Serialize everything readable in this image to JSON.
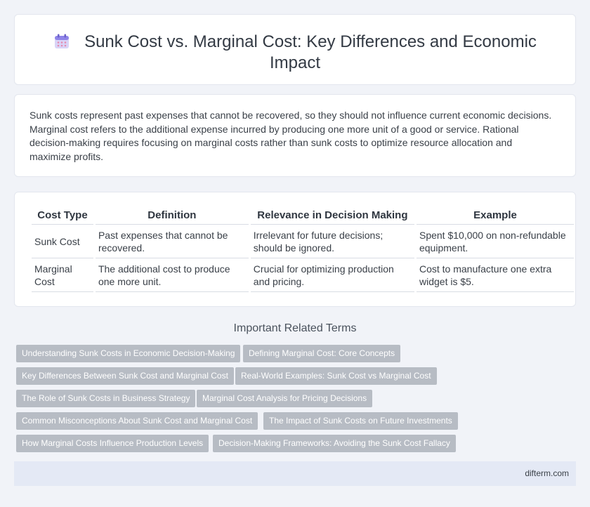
{
  "header": {
    "title": "Sunk Cost vs. Marginal Cost: Key Differences and Economic Impact",
    "icon": "calendar-icon"
  },
  "intro": {
    "text": "Sunk costs represent past expenses that cannot be recovered, so they should not influence current economic decisions. Marginal cost refers to the additional expense incurred by producing one more unit of a good or service. Rational decision-making requires focusing on marginal costs rather than sunk costs to optimize resource allocation and maximize profits."
  },
  "table": {
    "headers": [
      "Cost Type",
      "Definition",
      "Relevance in Decision Making",
      "Example"
    ],
    "rows": [
      [
        "Sunk Cost",
        "Past expenses that cannot be recovered.",
        "Irrelevant for future decisions; should be ignored.",
        "Spent $10,000 on non-refundable equipment."
      ],
      [
        "Marginal Cost",
        "The additional cost to produce one more unit.",
        "Crucial for optimizing production and pricing.",
        "Cost to manufacture one extra widget is $5."
      ]
    ]
  },
  "related": {
    "title": "Important Related Terms",
    "tags": [
      "Understanding Sunk Costs in Economic Decision-Making",
      "Defining Marginal Cost: Core Concepts",
      "Key Differences Between Sunk Cost and Marginal Cost",
      "Real-World Examples: Sunk Cost vs Marginal Cost",
      "The Role of Sunk Costs in Business Strategy",
      "Marginal Cost Analysis for Pricing Decisions",
      "Common Misconceptions About Sunk Cost and Marginal Cost",
      "The Impact of Sunk Costs on Future Investments",
      "How Marginal Costs Influence Production Levels",
      "Decision-Making Frameworks: Avoiding the Sunk Cost Fallacy"
    ]
  },
  "footer": {
    "site": "difterm.com"
  },
  "colors": {
    "tag_bg": "#b7bcc4",
    "footer_bg": "#e4e9f5",
    "page_bg": "#f1f3f8"
  }
}
